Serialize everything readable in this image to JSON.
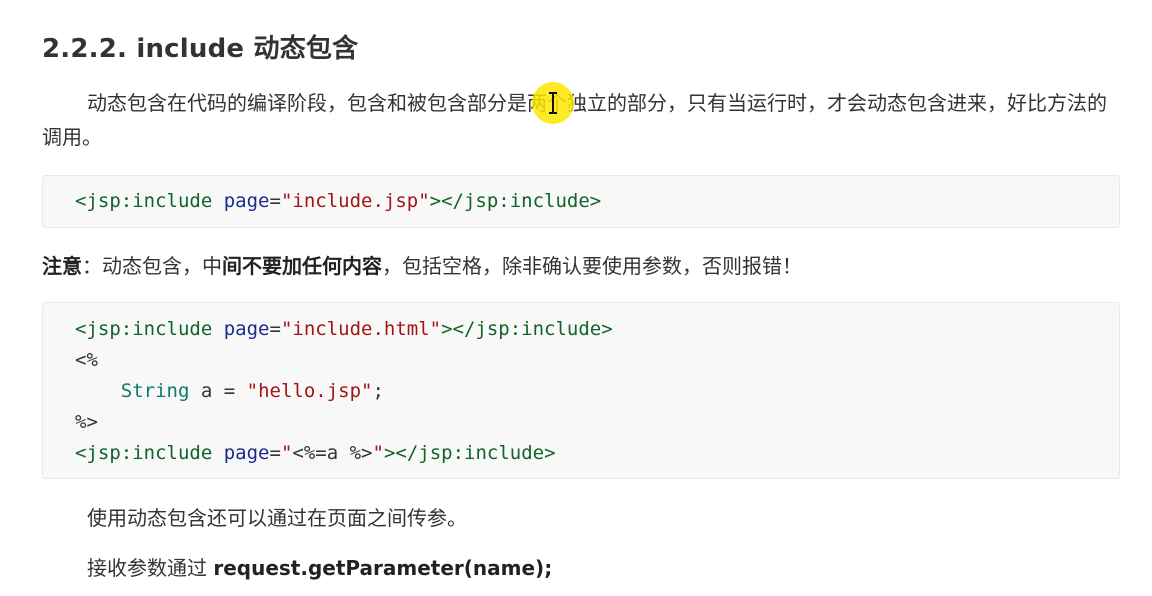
{
  "heading": "2.2.2. include 动态包含",
  "para1": "动态包含在代码的编译阶段，包含和被包含部分是两个独立的部分，只有当运行时，才会动态包含进来，好比方法的调用。",
  "code1": {
    "tag_open": "<jsp:include",
    "attr_name": " page",
    "eq": "=",
    "attr_value": "\"include.jsp\"",
    "tag_close": "></jsp:include>"
  },
  "note": {
    "label": "注意",
    "colon": "：动态包含，中",
    "bold_text": "间不要加任何内容",
    "rest": "，包括空格，除非确认要使用参数，否则报错！"
  },
  "code2": {
    "line1": {
      "tag_open": "<jsp:include",
      "attr_name": " page",
      "eq": "=",
      "attr_value": "\"include.html\"",
      "tag_close": "></jsp:include>"
    },
    "line2": "<%",
    "line3": {
      "indent": "    ",
      "type": "String",
      "var": " a ",
      "eq": "=",
      "space": " ",
      "value": "\"hello.jsp\"",
      "semi": ";"
    },
    "line4": "%>",
    "line5": {
      "tag_open": "<jsp:include",
      "attr_name": " page",
      "eq": "=",
      "value_open": "\"",
      "scriptlet_open": "<%=",
      "scriptlet_body": "a %>",
      "value_close": "\"",
      "tag_close": "></jsp:include>"
    }
  },
  "para3": "使用动态包含还可以通过在页面之间传参。",
  "para4": {
    "text": "接收参数通过 ",
    "bold": "request.getParameter(name);"
  }
}
